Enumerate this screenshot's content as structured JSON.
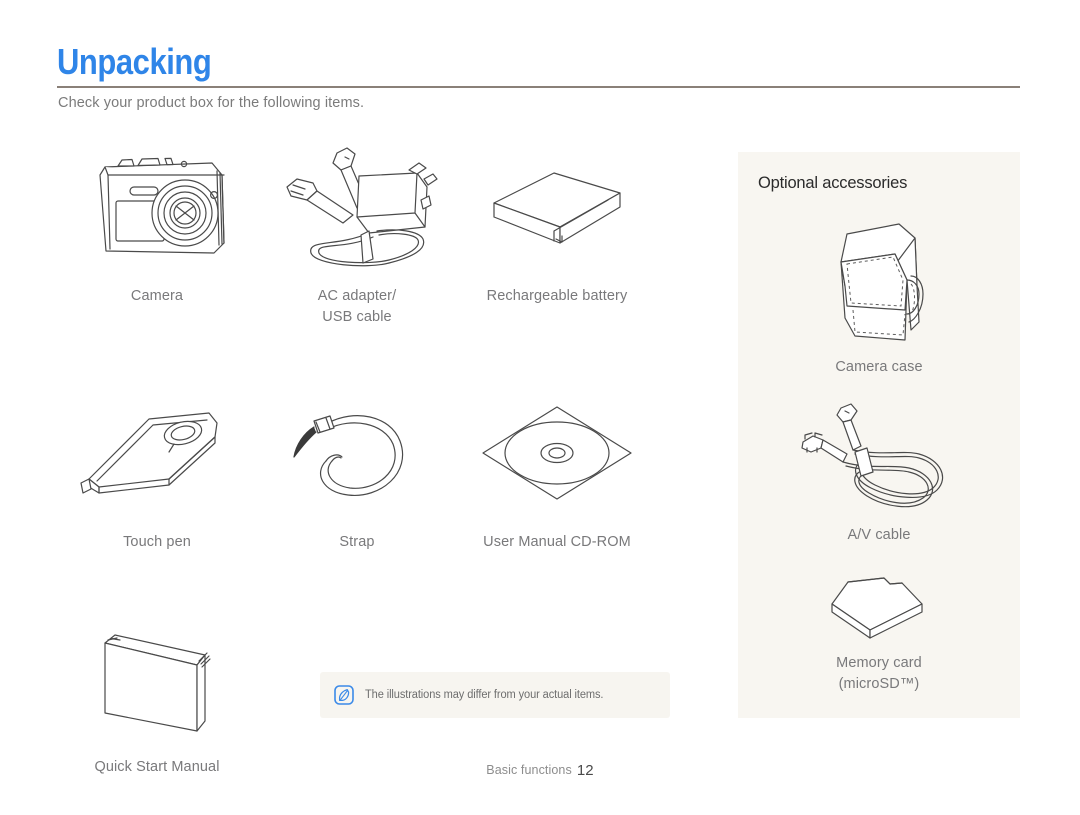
{
  "header": {
    "title": "Unpacking",
    "title_color": "#2f85e8",
    "intro": "Check your product box for the following items."
  },
  "items": [
    [
      {
        "label": "Camera",
        "icon": "camera-icon"
      },
      {
        "label": "AC adapter/\nUSB cable",
        "icon": "ac-adapter-usb-cable-icon"
      },
      {
        "label": "Rechargeable battery",
        "icon": "battery-icon"
      }
    ],
    [
      {
        "label": "Touch pen",
        "icon": "touch-pen-icon"
      },
      {
        "label": "Strap",
        "icon": "strap-icon"
      },
      {
        "label": "User Manual CD-ROM",
        "icon": "cd-rom-icon"
      }
    ],
    [
      {
        "label": "Quick Start Manual",
        "icon": "quick-start-manual-icon"
      }
    ]
  ],
  "note": {
    "icon": "note-pen-icon",
    "icon_color": "#3b8ae8",
    "text": "The illustrations may differ from your actual items.",
    "background": "#f7f5f0"
  },
  "optional": {
    "heading": "Optional accessories",
    "background": "#f8f6f1",
    "items": [
      {
        "label": "Camera case",
        "icon": "camera-case-icon"
      },
      {
        "label": "A/V cable",
        "icon": "av-cable-icon"
      },
      {
        "label": "Memory card\n(microSD™)",
        "icon": "memory-card-icon"
      }
    ]
  },
  "footer": {
    "section": "Basic functions",
    "page": "12"
  }
}
